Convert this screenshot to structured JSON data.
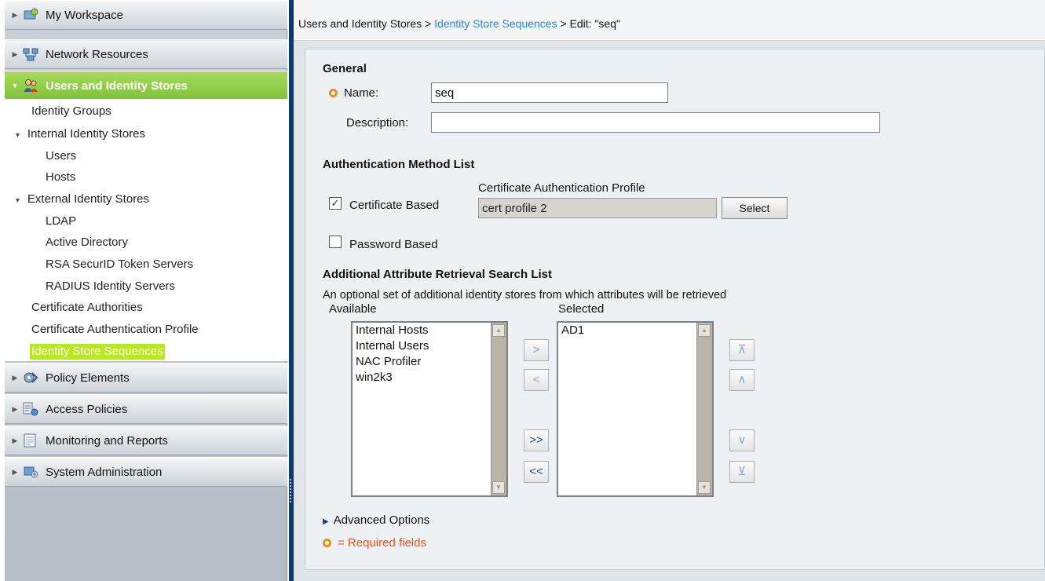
{
  "sidebar": {
    "drawers": [
      {
        "label": "My Workspace",
        "icon": "workspace-icon"
      },
      {
        "label": "Network Resources",
        "icon": "network-icon"
      },
      {
        "label": "Users and Identity Stores",
        "icon": "users-icon"
      },
      {
        "label": "Policy Elements",
        "icon": "policy-elements-icon"
      },
      {
        "label": "Access Policies",
        "icon": "access-policies-icon"
      },
      {
        "label": "Monitoring and Reports",
        "icon": "monitoring-icon"
      },
      {
        "label": "System Administration",
        "icon": "system-admin-icon"
      }
    ],
    "tree": {
      "identity_groups": "Identity Groups",
      "internal_stores": "Internal Identity Stores",
      "users": "Users",
      "hosts": "Hosts",
      "external_stores": "External Identity Stores",
      "ldap": "LDAP",
      "active_directory": "Active Directory",
      "rsa": "RSA SecurID Token Servers",
      "radius": "RADIUS Identity Servers",
      "cert_authorities": "Certificate Authorities",
      "cert_auth_profile": "Certificate Authentication Profile",
      "identity_store_sequences": "Identity Store Sequences"
    },
    "accent_color": "#8ccb45"
  },
  "breadcrumb": {
    "root": "Users and Identity Stores",
    "sep1": " > ",
    "link": "Identity Store Sequences",
    "sep2": " > ",
    "current": "Edit: \"seq\""
  },
  "form": {
    "general_title": "General",
    "name_label": "Name:",
    "name_value": "seq",
    "description_label": "Description:",
    "description_value": "",
    "auth_title": "Authentication Method List",
    "cert_profile_label": "Certificate Authentication Profile",
    "cert_based_label": "Certificate Based",
    "cert_based_checked": true,
    "cert_profile_value": "cert profile 2",
    "select_button": "Select",
    "password_based_label": "Password Based",
    "password_based_checked": false,
    "attr_title": "Additional Attribute Retrieval Search List",
    "attr_desc": "An optional set of additional identity stores from which attributes will be retrieved",
    "available_label": "Available",
    "selected_label": "Selected",
    "available_items": [
      "Internal Hosts",
      "Internal Users",
      "NAC Profiler",
      "win2k3"
    ],
    "selected_items": [
      "AD1"
    ],
    "move_buttons": {
      "right": ">",
      "left": "<",
      "all_right": ">>",
      "all_left": "<<"
    },
    "order_buttons": {
      "top": "⊼",
      "up": "∧",
      "down": "∨",
      "bottom": "⊻"
    },
    "advanced_options": "Advanced Options",
    "required_note": "= Required fields"
  }
}
